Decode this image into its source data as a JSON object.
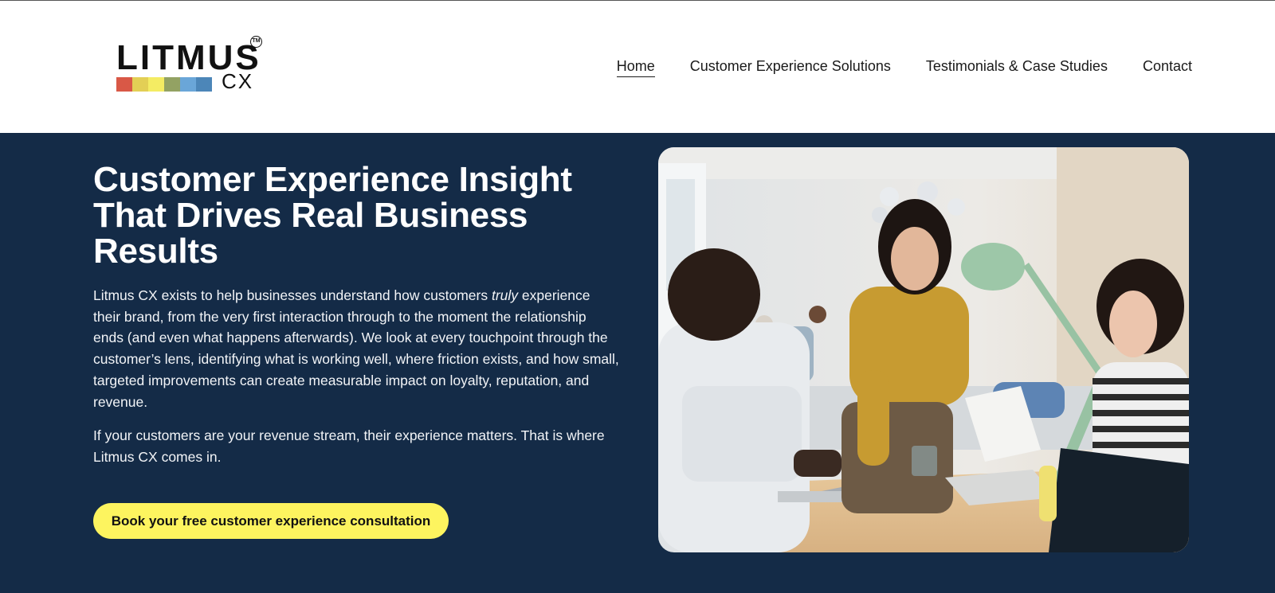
{
  "brand": {
    "wordmark": "LITMUS",
    "sub": "CX",
    "tm": "TM",
    "bar_colors": [
      "#d95846",
      "#e3cf55",
      "#f4ec63",
      "#93a263",
      "#6aa6d8",
      "#4c86b8"
    ]
  },
  "nav": {
    "items": [
      {
        "label": "Home",
        "active": true
      },
      {
        "label": "Customer Experience Solutions",
        "active": false
      },
      {
        "label": "Testimonials & Case Studies",
        "active": false
      },
      {
        "label": "Contact",
        "active": false
      }
    ]
  },
  "hero": {
    "title": "Customer Experience Insight That Drives Real Business Results",
    "paragraph1": {
      "before": "Litmus CX exists to help businesses understand how customers ",
      "emphasis": "truly",
      "after": " experience their brand, from the very first interaction through to the moment the relationship ends (and even what happens afterwards). We look at every touchpoint through the customer’s lens, identifying what is working well, where friction exists, and how small, targeted improvements can create measurable impact on loyalty, reputation, and revenue."
    },
    "paragraph2": "If your customers are your revenue stream, their experience matters. That is where Litmus CX comes in.",
    "cta_label": "Book your free customer experience consultation"
  },
  "colors": {
    "hero_background": "#142b47",
    "cta_background": "#fdf45f",
    "header_background": "#ffffff"
  }
}
